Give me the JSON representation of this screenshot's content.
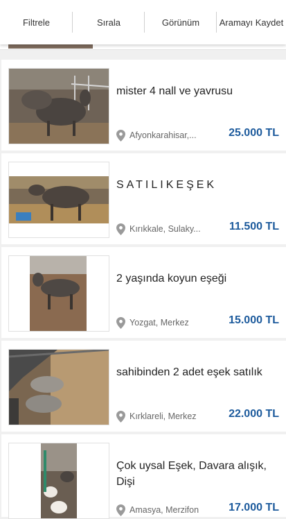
{
  "toolbar": {
    "filter_label": "Filtrele",
    "sort_label": "Sırala",
    "view_label": "Görünüm",
    "save_search_label": "Aramayı Kaydet"
  },
  "listings": [
    {
      "title": "mister 4 nall ve yavrusu",
      "location": "Afyonkarahisar,...",
      "price": "25.000 TL"
    },
    {
      "title": "SATILIKEŞEK",
      "location": "Kırıkkale, Sulaky...",
      "price": "11.500 TL"
    },
    {
      "title": "2 yaşında koyun eşeği",
      "location": "Yozgat, Merkez",
      "price": "15.000 TL"
    },
    {
      "title": "sahibinden 2 adet eşek satılık",
      "location": "Kırklareli, Merkez",
      "price": "22.000 TL"
    },
    {
      "title": "Çok uysal Eşek, Davara alışık, Dişi",
      "location": "Amasya, Merzifon",
      "price": "17.000 TL"
    }
  ],
  "colors": {
    "price": "#1c5a9c",
    "toolbar_bg": "#ffffff",
    "page_bg": "#f0f0f0"
  },
  "icons": {
    "location": "map-pin-icon"
  }
}
